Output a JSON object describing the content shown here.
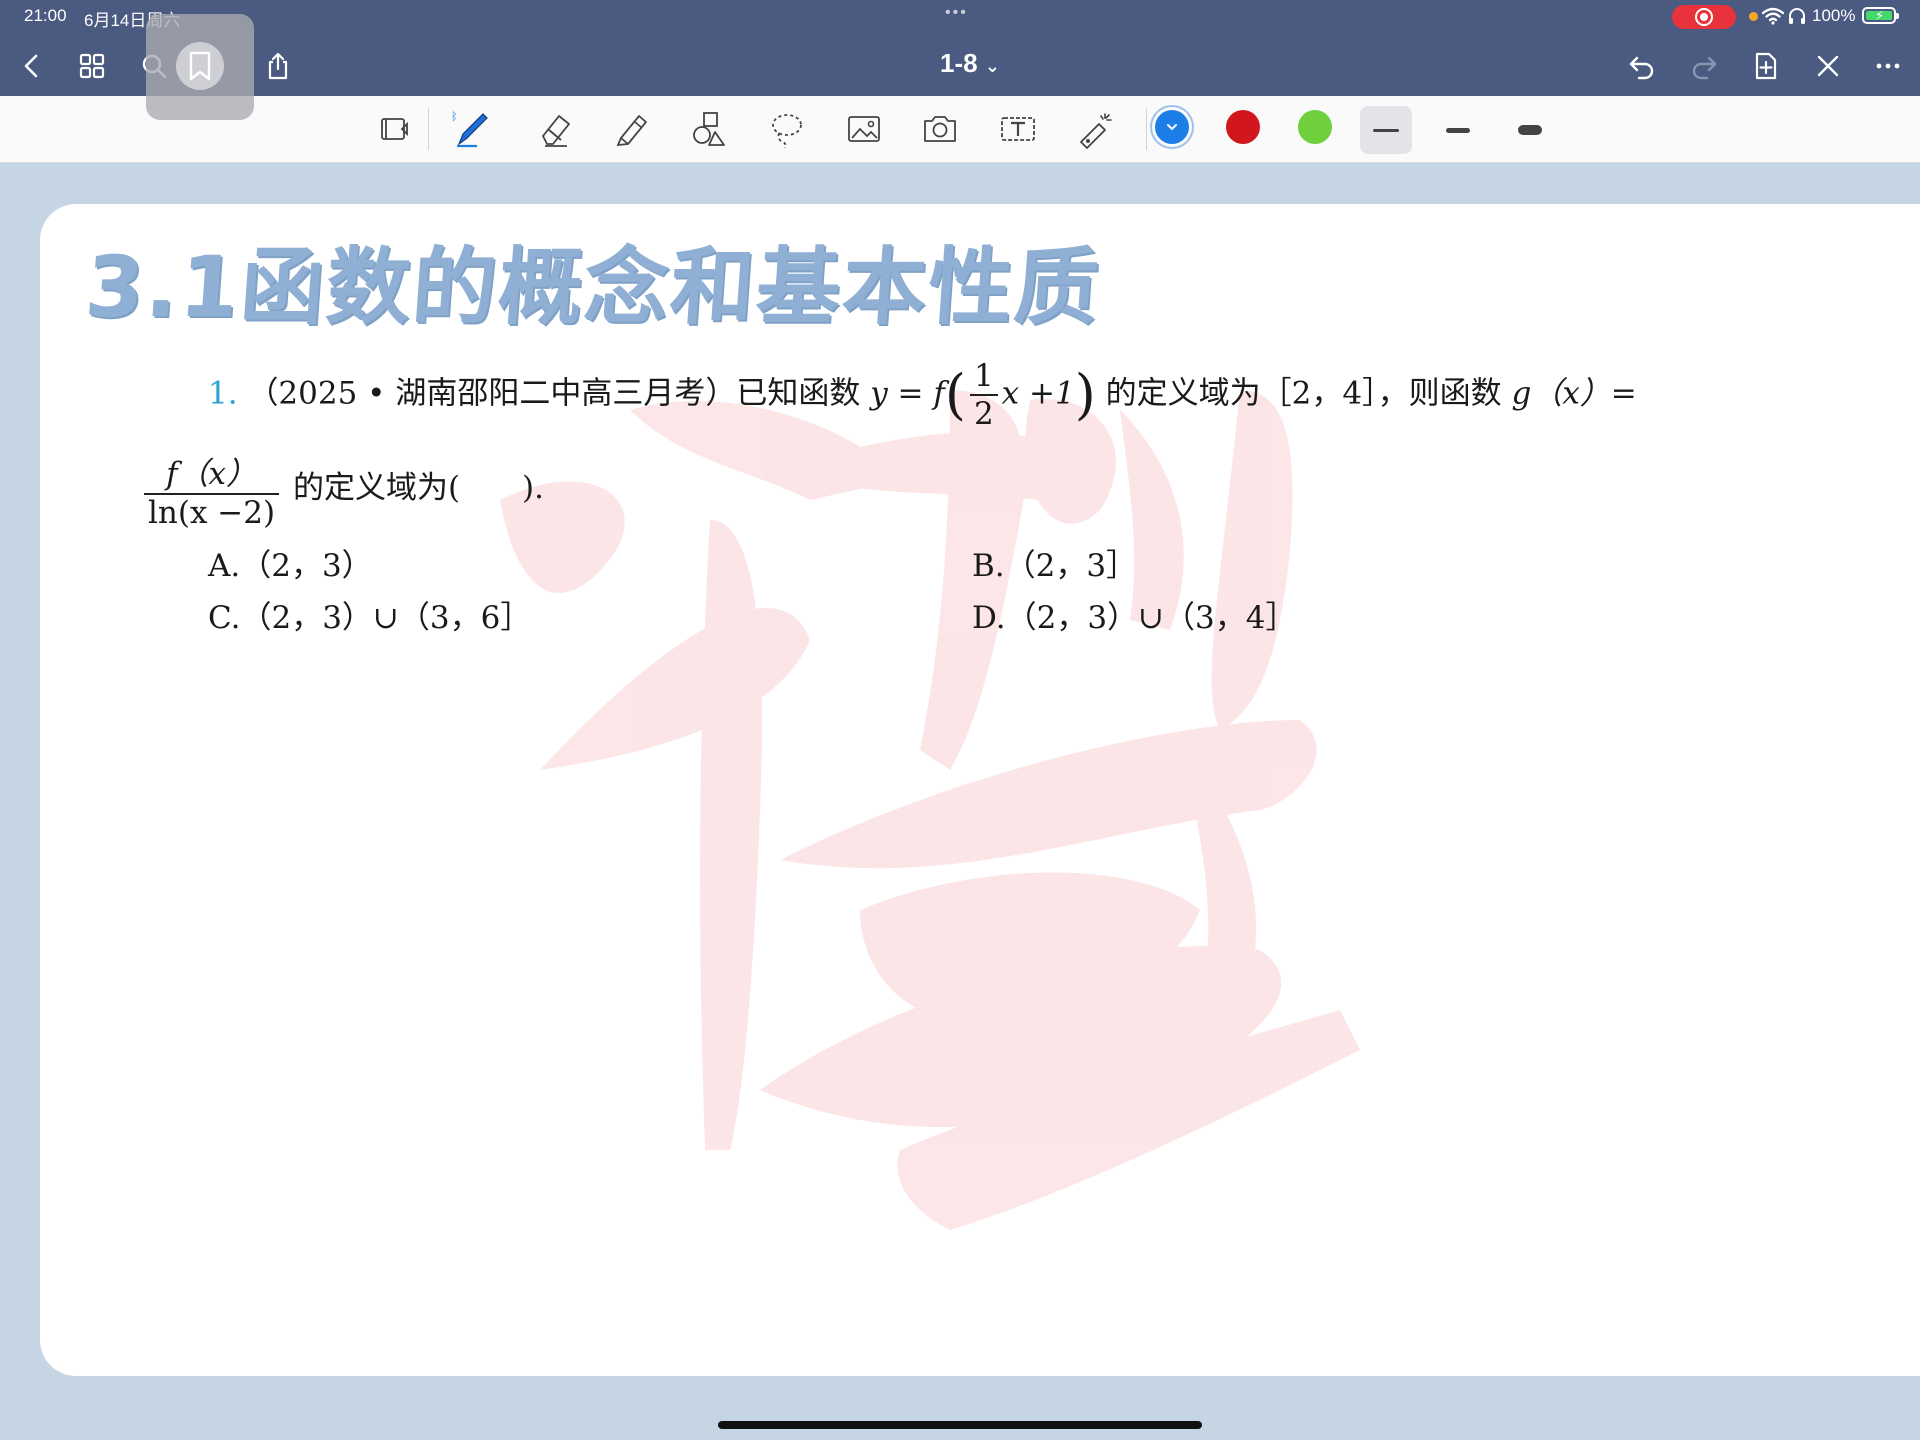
{
  "status_bar": {
    "time": "21:00",
    "date": "6月14日周六",
    "battery": "100%"
  },
  "nav": {
    "title": "1-8",
    "title_chevron": "⌄"
  },
  "toolbar": {
    "tools": [
      "page-layout-icon",
      "pen-icon",
      "eraser-icon",
      "highlighter-icon",
      "shapes-icon",
      "lasso-icon",
      "image-icon",
      "camera-icon",
      "text-box-icon",
      "laser-pointer-icon"
    ],
    "colors": [
      "#1e7ee8",
      "#d2161e",
      "#6fcf3d"
    ],
    "selected_color": "#1e7ee8"
  },
  "document": {
    "heading": "3.1函数的概念和基本性质",
    "question": {
      "number": "1.",
      "source": "（2025 • 湖南邵阳二中高三月考）已知函数",
      "y_eq": "y = f",
      "frac_half_num": "1",
      "frac_half_den": "2",
      "inner": "x +1",
      "domain_text": "的定义域为［2，4］，则函数",
      "g_eq": "g（x）=",
      "frac_g_num": "f（x）",
      "frac_g_den": "ln(x −2)",
      "tail": "的定义域为(　　).",
      "options": {
        "A": "A.（2，3）",
        "B": "B.（2，3］",
        "C": "C.（2，3）∪（3，6］",
        "D": "D.（2，3）∪（3，4］"
      }
    }
  }
}
